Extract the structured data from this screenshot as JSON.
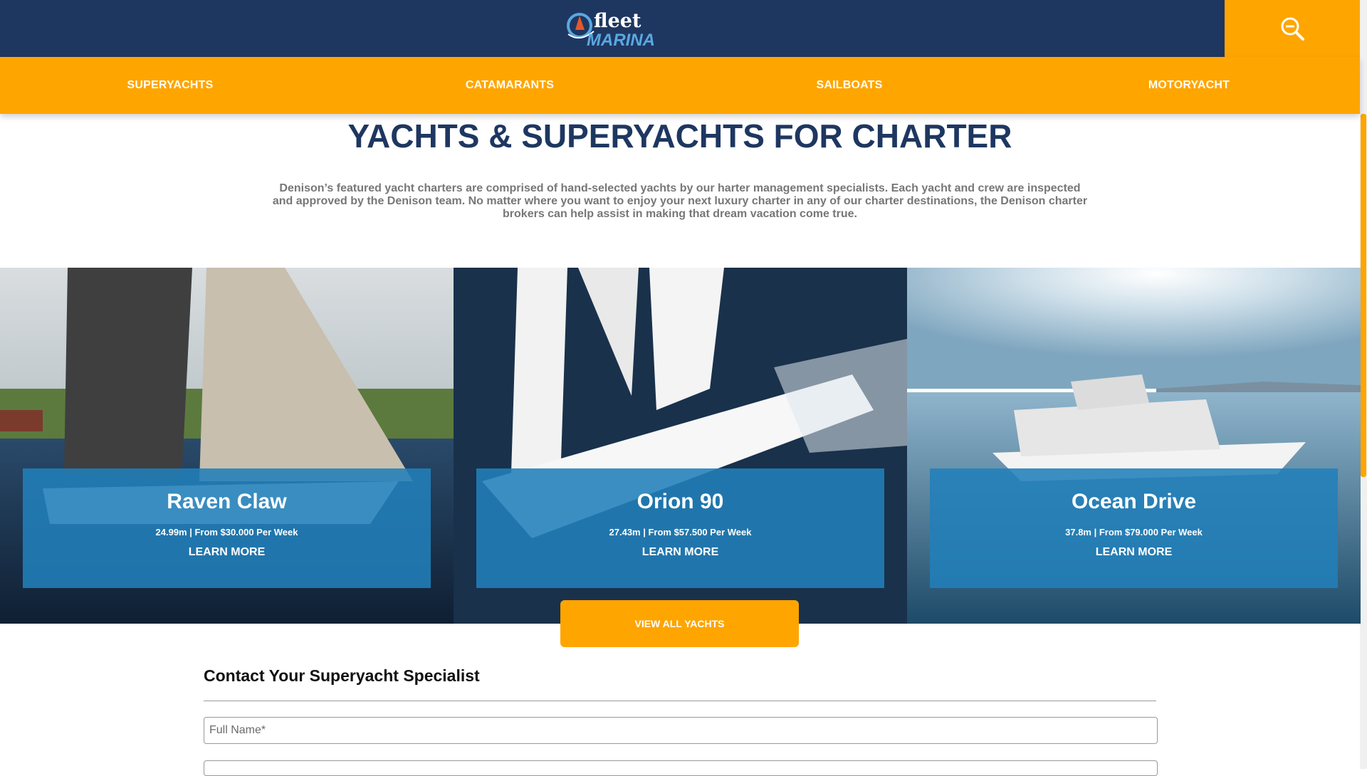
{
  "header": {
    "logo_word_top": "fleet",
    "logo_word_bottom": "MARINA",
    "colors": {
      "navy": "#1e3761",
      "orange": "#ffa500",
      "card_blue": "#2180ba"
    }
  },
  "nav": {
    "items": [
      {
        "label": "SUPERYACHTS"
      },
      {
        "label": "CATAMARANTS"
      },
      {
        "label": "SAILBOATS"
      },
      {
        "label": "MOTORYACHT"
      }
    ]
  },
  "main": {
    "title": "YACHTS & SUPERYACHTS FOR CHARTER",
    "intro": "Denison’s featured yacht charters are comprised of hand-selected yachts by our harter management specialists. Each yacht and crew are inspected and approved by the Denison team. No matter where you want to enjoy your next luxury charter in any of our charter destinations, the Denison charter brokers can help assist in making that dream vacation come true."
  },
  "yachts": [
    {
      "name": "Raven Claw",
      "meta": "24.99m | From $30.000 Per Week",
      "link": "LEARN MORE"
    },
    {
      "name": "Orion 90",
      "meta": "27.43m | From $57.500 Per Week",
      "link": "LEARN MORE"
    },
    {
      "name": "Ocean Drive",
      "meta": "37.8m | From $79.000 Per Week",
      "link": "LEARN MORE"
    }
  ],
  "view_all_label": "VIEW ALL YACHTS",
  "contact": {
    "title": "Contact Your Superyacht Specialist",
    "full_name_placeholder": "Full Name*"
  }
}
